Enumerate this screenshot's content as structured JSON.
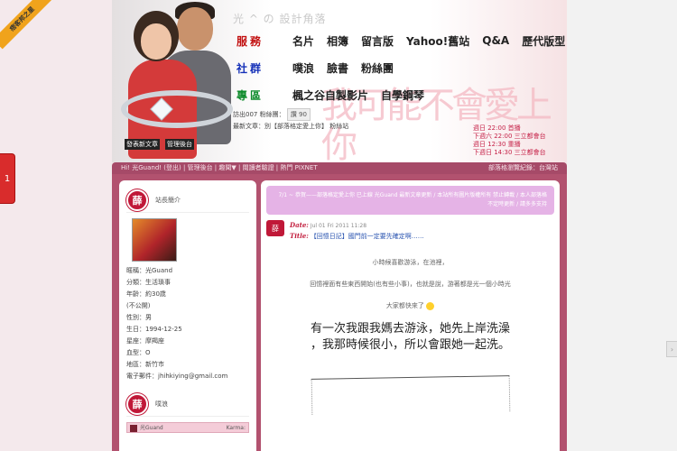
{
  "ribbon": {
    "label": "痞客邦之星"
  },
  "left_tab": {
    "label": "1"
  },
  "banner": {
    "site_title": "光 ^ の 設計角落",
    "menu": [
      {
        "category": "服務",
        "items": [
          "名片",
          "相簿",
          "留言版",
          "Yahoo!舊站",
          "Q&A",
          "歷代版型"
        ]
      },
      {
        "category": "社群",
        "items": [
          "噗浪",
          "臉書",
          "粉絲團"
        ]
      },
      {
        "category": "專區",
        "items": [
          "楓之谷自製影片",
          "自學鋼琴"
        ]
      }
    ],
    "big_title": "我可能不會愛上你",
    "stats_line": "訪出007 粉絲團：",
    "like_label": "讚 90",
    "update_line": "最新文章：別【部落格定愛上你】 粉絲站",
    "couple_buttons": [
      "發表新文章",
      "管理後台"
    ],
    "schedule": [
      "週日 22:00 首播",
      "下週六 22:00 三立都會台",
      "週日 12:30 重播",
      "下週日 14:30 三立都會台"
    ]
  },
  "navbar": {
    "left": "Hi! 光Guand! (登出) | 管理後台 | 趣聞▼ | 閱讀者驗證 | 熱門 PIXNET",
    "right": "部落格瀏覽紀錄：台灣站"
  },
  "sidebar": {
    "badge": "薛",
    "header_title": "站長簡介",
    "profile": [
      "暱稱：光Guand",
      "分類：生活瑣事",
      "年齡：約30歲",
      "(不公開)",
      "性別：男",
      "生日：1994-12-25",
      "星座：摩羯座",
      "血型：O",
      "地區：新竹市",
      "電子郵件：jhihkiying@gmail.com"
    ],
    "plurk_badge": "薛",
    "plurk_title": "噗浪",
    "plurk_user": "光Guand",
    "karma_label": "Karma:"
  },
  "main": {
    "notice": "7/1 ~ 恭賀——部落格定愛上你 已上線 光Guand 最新文章更新 / 本站所有圖片版權所有 禁止轉載 / 本人部落格不定時更新 / 請多多支持",
    "post_icon": "薛",
    "date_label": "Date:",
    "date_value": "Jul 01 Fri 2011 11:28",
    "title_label": "Title:",
    "post_title": "【回憶日記】國門前一定要先確定啊……",
    "line1": "小時候喜歡游泳，在池裡，",
    "line2": "回憶裡面有些東西開始(也有些小事)，也就是說，游著都是光一個小時光",
    "line3": "大家都快來了",
    "big_line1": "有一次我跟我媽去游泳，她先上岸洗澡",
    "big_line2": "，我那時候很小，所以會跟她一起洗。"
  }
}
